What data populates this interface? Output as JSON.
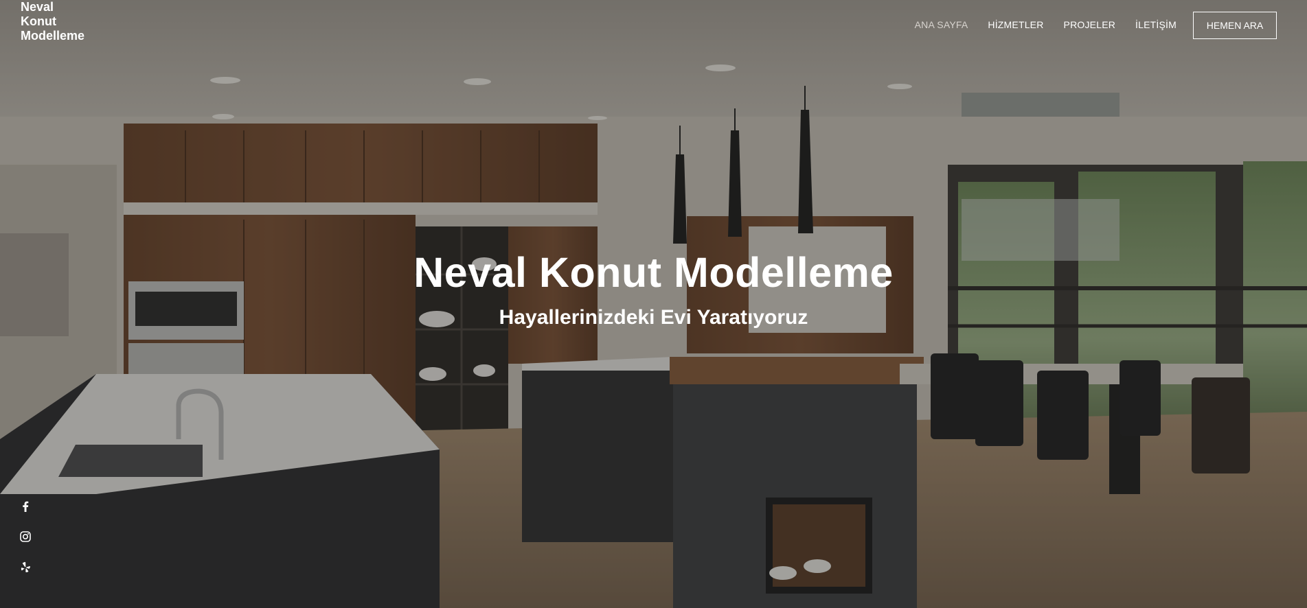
{
  "brand": {
    "logo_line1": "Neval",
    "logo_line2": "Konut",
    "logo_line3": "Modelleme"
  },
  "nav": {
    "items": [
      {
        "label": "ANA SAYFA",
        "active": true
      },
      {
        "label": "HİZMETLER",
        "active": false
      },
      {
        "label": "PROJELER",
        "active": false
      },
      {
        "label": "İLETİŞİM",
        "active": false
      }
    ],
    "cta_label": "HEMEN ARA"
  },
  "hero": {
    "title": "Neval Konut Modelleme",
    "subtitle": "Hayallerinizdeki Evi Yaratıyoruz",
    "image_alt": "Modern mutfak ve yemek alanı"
  },
  "social": {
    "icons": [
      "facebook-icon",
      "instagram-icon",
      "yelp-icon"
    ]
  },
  "colors": {
    "text": "#ffffff",
    "nav_active": "#d7d3ce",
    "overlay": "rgba(30,28,26,0.38)"
  }
}
